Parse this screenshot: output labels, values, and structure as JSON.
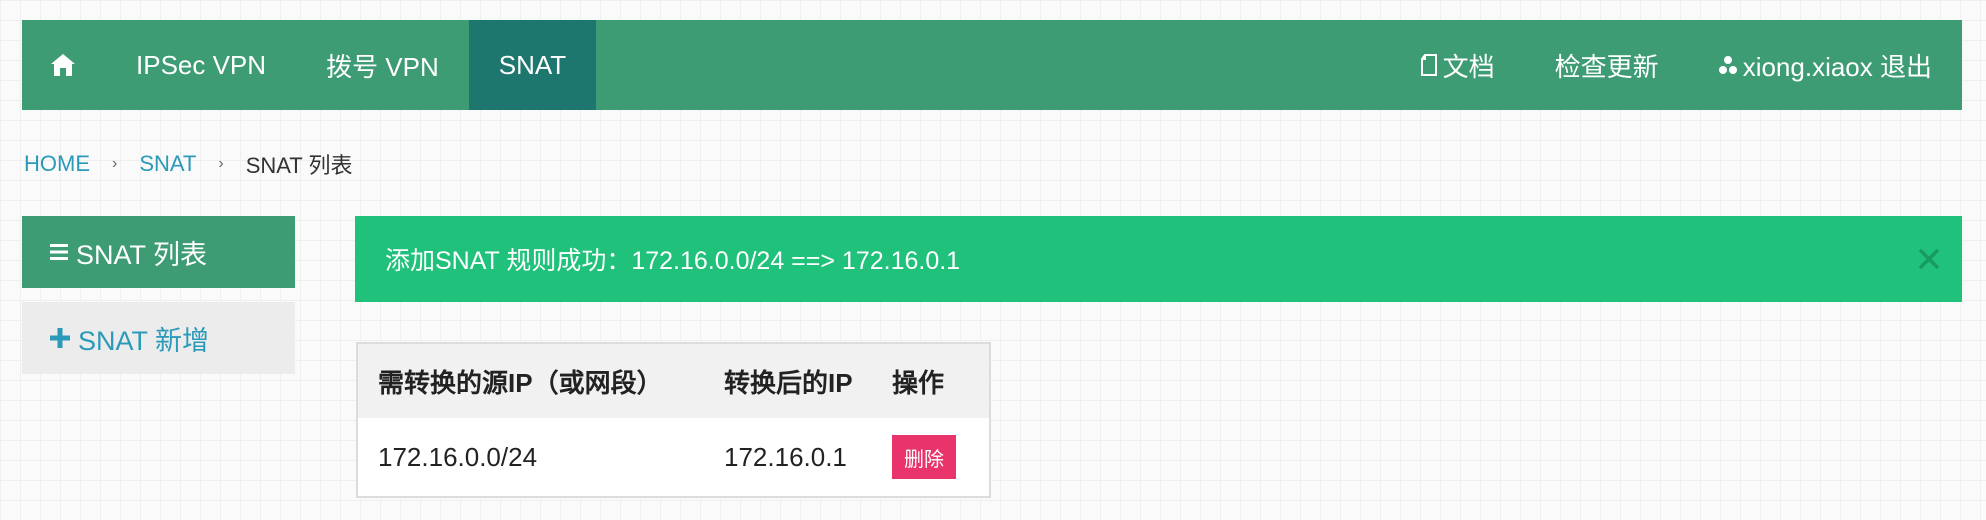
{
  "nav": {
    "left": [
      {
        "icon": "home-icon",
        "label": ""
      },
      {
        "label": "IPSec VPN"
      },
      {
        "label": "拨号 VPN"
      },
      {
        "label": "SNAT",
        "active": true
      }
    ],
    "right": {
      "docs_label": "文档",
      "update_label": "检查更新",
      "user_label": "xiong.xiaox 退出"
    }
  },
  "breadcrumb": {
    "home": "HOME",
    "section": "SNAT",
    "current": "SNAT 列表",
    "separator": "›"
  },
  "sidebar": {
    "items": [
      {
        "label": "SNAT 列表",
        "icon": "list-icon",
        "active": true
      },
      {
        "label": "SNAT 新增",
        "icon": "plus-icon",
        "active": false
      }
    ]
  },
  "alert": {
    "message": "添加SNAT 规则成功：172.16.0.0/24 ==> 172.16.0.1",
    "close_icon": "close-icon"
  },
  "table": {
    "headers": [
      "需转换的源IP（或网段）",
      "转换后的IP",
      "操作"
    ],
    "rows": [
      {
        "source": "172.16.0.0/24",
        "target": "172.16.0.1",
        "action": "删除"
      }
    ]
  },
  "colors": {
    "navbar": "#3d9c74",
    "navbar_active": "#1e776f",
    "alert": "#1fc17b",
    "link": "#2a9ab8",
    "delete": "#e8346a"
  }
}
